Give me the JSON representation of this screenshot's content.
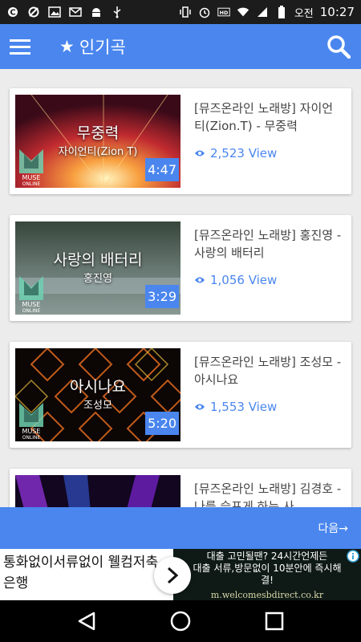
{
  "status_bar": {
    "carrier": "오전",
    "time": "10:27",
    "icons_left": [
      "c-icon",
      "no-sync-icon",
      "image-icon",
      "mail-icon",
      "android-icon",
      "usb-icon"
    ],
    "icons_right": [
      "vibrate-icon",
      "alarm-icon",
      "hd-icon",
      "wifi-icon",
      "signal-icon",
      "battery-icon"
    ]
  },
  "appbar": {
    "title": "인기곡",
    "star": "★"
  },
  "songs": [
    {
      "thumb_title": "무중력",
      "thumb_artist": "자이언티(Zion T)",
      "duration": "4:47",
      "name": "[뮤즈온라인 노래방] 자이언티(Zion.T) - 무중력",
      "views": "2,523 View",
      "colors": [
        "#7a1020",
        "#d84030",
        "#f8c040"
      ]
    },
    {
      "thumb_title": "사랑의 배터리",
      "thumb_artist": "홍진영",
      "duration": "3:29",
      "name": "[뮤즈온라인 노래방] 홍진영 - 사랑의 배터리",
      "views": "1,056 View",
      "colors": [
        "#2a4a40",
        "#7a9a90",
        "#c8d8d0"
      ]
    },
    {
      "thumb_title": "아시나요",
      "thumb_artist": "조성모",
      "duration": "5:20",
      "name": "[뮤즈온라인 노래방] 조성모 - 아시나요",
      "views": "1,553 View",
      "colors": [
        "#100806",
        "#a03018",
        "#f0a030"
      ]
    },
    {
      "thumb_title": "",
      "thumb_artist": "",
      "duration": "",
      "name": "[뮤즈온라인 노래방] 김경호 - 나를 슬프게 하는 사",
      "views": "",
      "colors": [
        "#1a0830",
        "#7a20b0",
        "#3050c0"
      ]
    }
  ],
  "next_button": "다음→",
  "ad": {
    "left_text": "통화없이서류없이 웰컴저축은행",
    "right_line1": "대출 고민될땐? 24시간언제든",
    "right_line2": "대출 서류,방문없이 10분안에 즉시해결!",
    "url": "m.welcomesbdirect.co.kr"
  },
  "logo_text": [
    "MUSE",
    "ONLINE"
  ]
}
